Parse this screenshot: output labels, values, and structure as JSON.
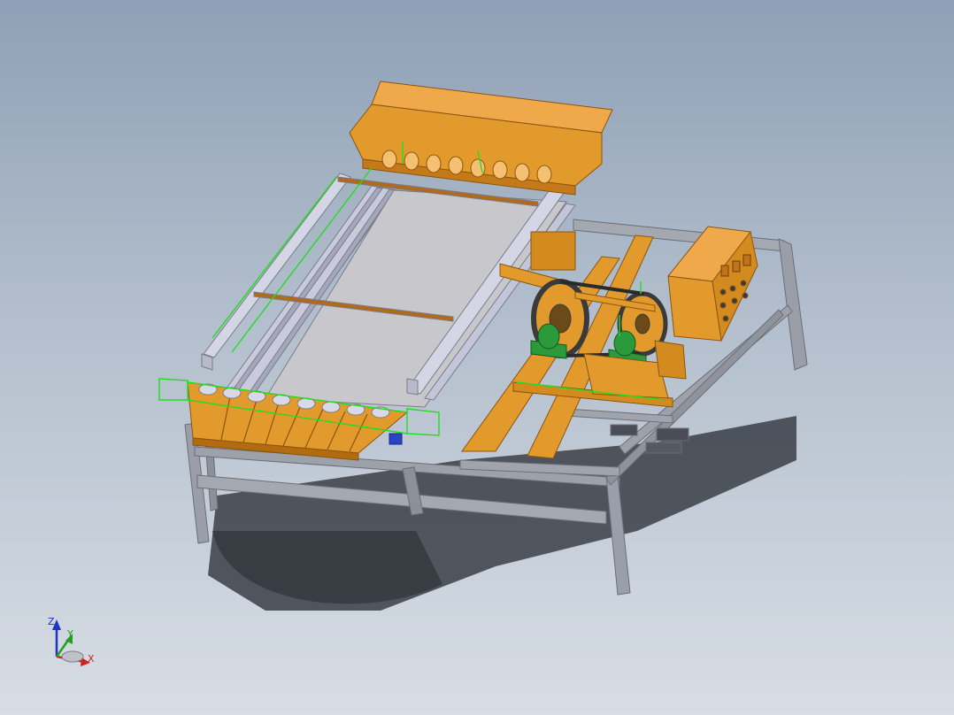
{
  "triad": {
    "z_label": "Z",
    "y_label": "Y",
    "x_label": "X"
  },
  "colors": {
    "background_top": "#8fa0b6",
    "background_bottom": "#d7dde4",
    "frame": "#9a9ea8",
    "orange": "#e39a2c",
    "orange_dark": "#b36b12",
    "deck": "#c9c9cd",
    "rail": "#d4d6e6",
    "selection": "#22dd22",
    "bearing": "#2a9a3a",
    "pulley": "#3a3a3a"
  }
}
